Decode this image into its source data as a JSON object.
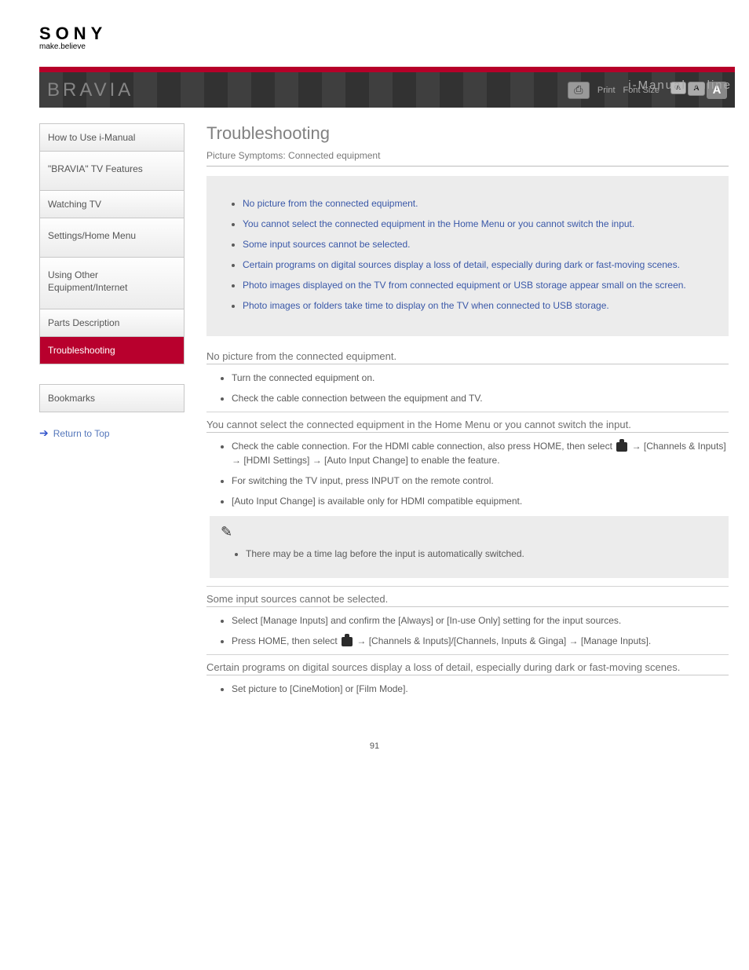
{
  "logo": {
    "brand": "SONY",
    "tagline": "make.believe",
    "model": "BRAVIA",
    "imanual": "i-Manual online"
  },
  "header": {
    "print": "Print",
    "font_size": "Font Size"
  },
  "sidebar": {
    "items": [
      {
        "label": "How to Use i-Manual"
      },
      {
        "label": "\"BRAVIA\" TV Features"
      },
      {
        "label": "Watching TV"
      },
      {
        "label": "Settings/Home Menu"
      },
      {
        "label": "Using Other Equipment/Internet"
      },
      {
        "label": "Parts Description"
      },
      {
        "label": "Troubleshooting"
      }
    ],
    "bookmarks": "Bookmarks",
    "return": "Return to Top"
  },
  "content": {
    "title": "Troubleshooting",
    "breadcrumb": "Picture Symptoms: Connected equipment",
    "symptoms": [
      "No picture from the connected equipment.",
      "You cannot select the connected equipment in the Home Menu or you cannot switch the input.",
      "Some input sources cannot be selected.",
      "Certain programs on digital sources display a loss of detail, especially during dark or fast-moving scenes.",
      "Photo images displayed on the TV from connected equipment or USB storage appear small on the screen.",
      "Photo images or folders take time to display on the TV when connected to USB storage."
    ],
    "s1": {
      "title": "No picture from the connected equipment.",
      "items": [
        "Turn the connected equipment on.",
        "Check the cable connection between the equipment and TV."
      ]
    },
    "s2": {
      "title": "You cannot select the connected equipment in the Home Menu or you cannot switch the input.",
      "items": [
        {
          "pre": "Check the cable connection. For the HDMI cable connection, also press HOME, then select ",
          "icon": true,
          "mid": " → [Channels & Inputs] → [HDMI Settings] → [Auto Input Change] to enable the feature."
        },
        "For switching the TV input, press INPUT on the remote control.",
        "[Auto Input Change] is available only for HDMI compatible equipment."
      ],
      "note": "There may be a time lag before the input is automatically switched."
    },
    "s3": {
      "title": "Some input sources cannot be selected.",
      "items": [
        "Select [Manage Inputs] and confirm the [Always] or [In-use Only] setting for the input sources.",
        {
          "pre": "Press HOME, then select ",
          "icon": true,
          "post": " → [Channels & Inputs]/[Channels, Inputs & Ginga] → [Manage Inputs]."
        }
      ]
    },
    "s4": {
      "title": "Certain programs on digital sources display a loss of detail, especially during dark or fast-moving scenes.",
      "items": [
        "Set picture to [CineMotion] or [Film Mode]."
      ]
    }
  },
  "page_number": "91"
}
